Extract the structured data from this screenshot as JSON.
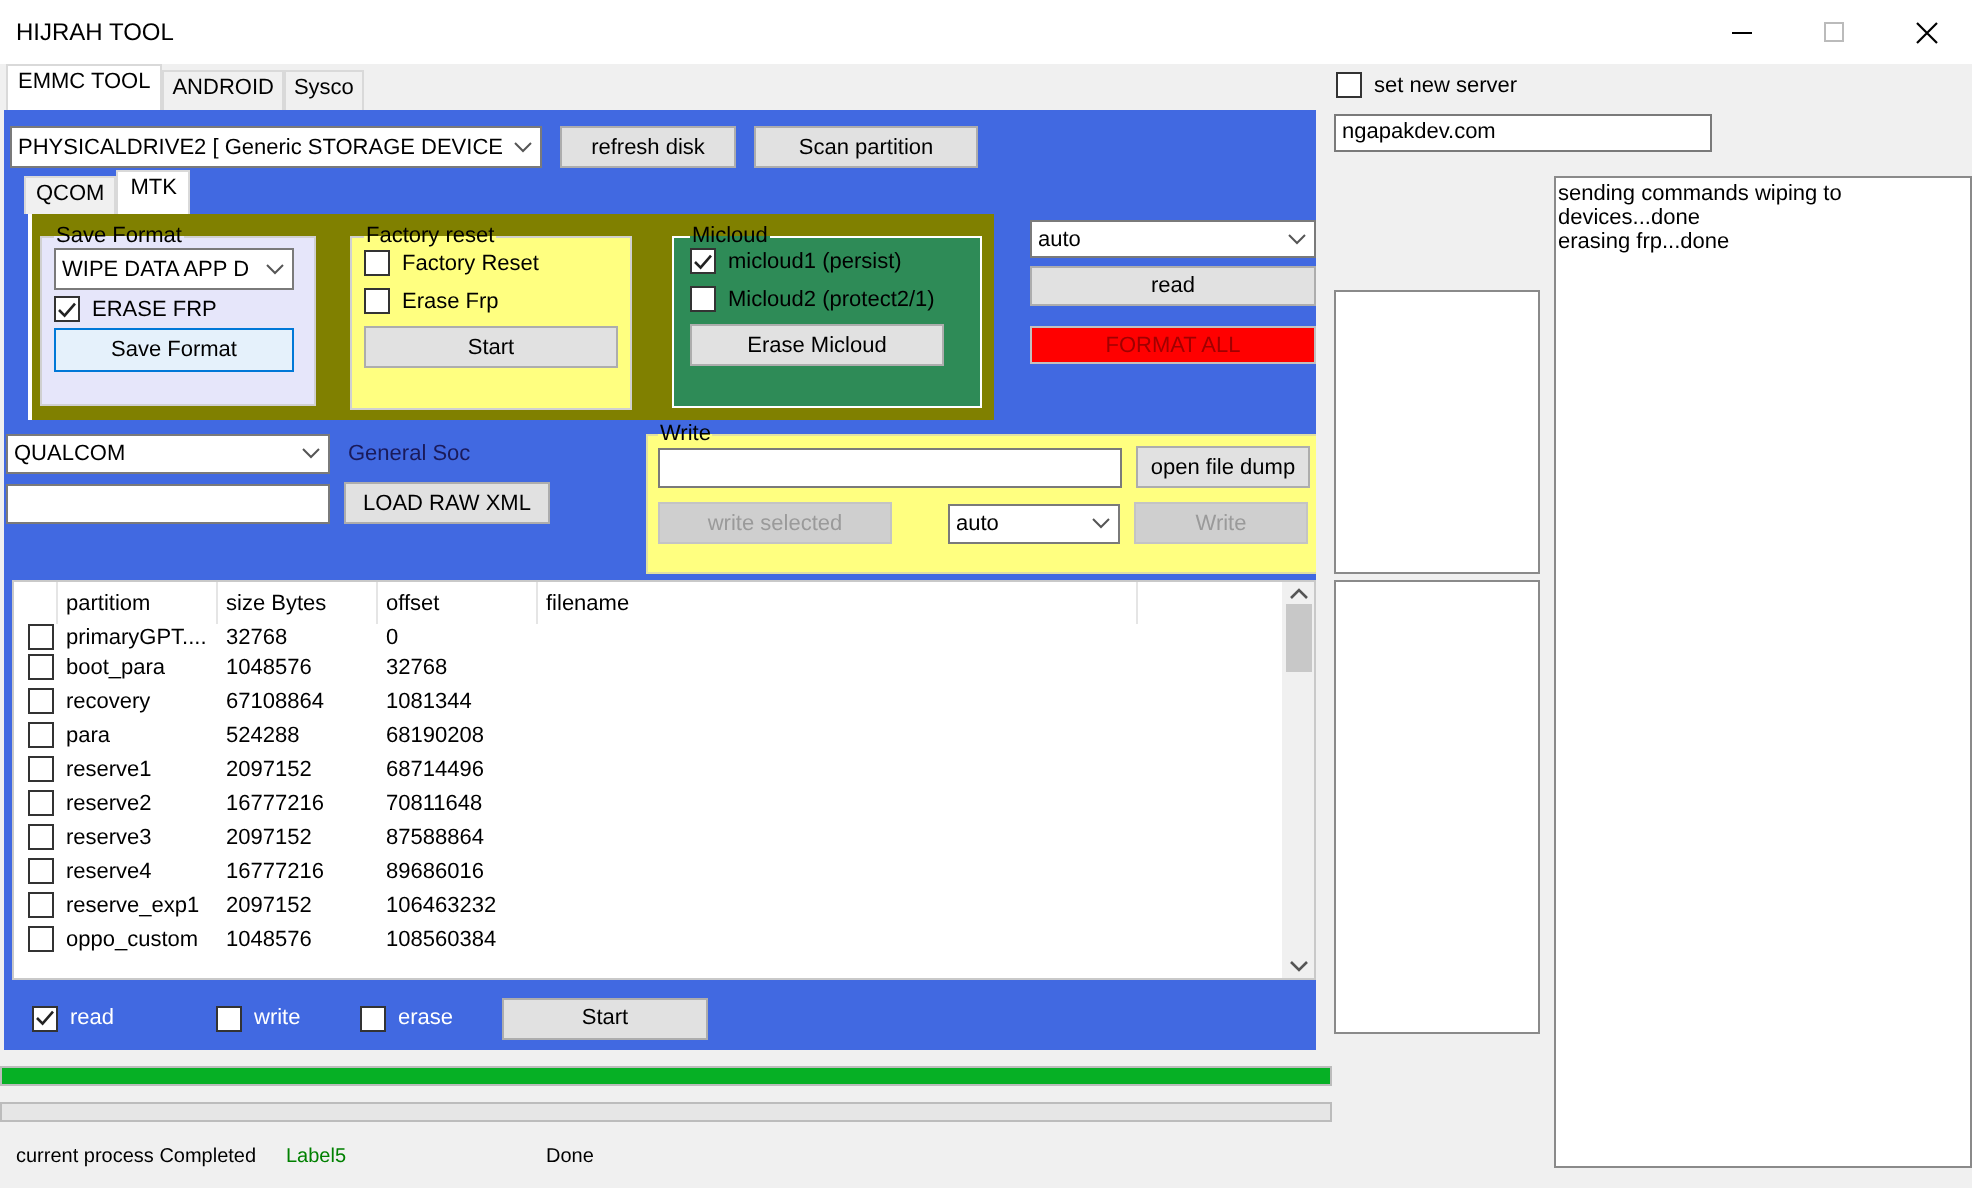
{
  "window": {
    "title": "HIJRAH TOOL"
  },
  "tabs": [
    {
      "label": "EMMC TOOL",
      "selected": true
    },
    {
      "label": "ANDROID",
      "selected": false
    },
    {
      "label": "Sysco",
      "selected": false
    }
  ],
  "disk": {
    "combo": "PHYSICALDRIVE2 [ Generic STORAGE DEVICE",
    "buttons": [
      "refresh disk",
      "Scan partition"
    ]
  },
  "chip_tabs": [
    {
      "label": "QCOM",
      "selected": false
    },
    {
      "label": "MTK",
      "selected": true
    }
  ],
  "save_format": {
    "title": "Save Format",
    "combo": "WIPE DATA APP D",
    "checkbox": {
      "label": "ERASE FRP",
      "checked": true
    },
    "button": "Save Format"
  },
  "factory_reset": {
    "title": "Factory reset",
    "checkboxes": [
      {
        "label": "Factory Reset",
        "checked": false
      },
      {
        "label": "Erase Frp",
        "checked": false
      }
    ],
    "button": "Start"
  },
  "micloud": {
    "title": "Micloud",
    "checkboxes": [
      {
        "label": "micloud1 (persist)",
        "checked": true
      },
      {
        "label": "Micloud2 (protect2/1)",
        "checked": false
      }
    ],
    "button": "Erase Micloud"
  },
  "read_panel": {
    "combo": "auto",
    "read_button": "read",
    "format_button": "FORMAT ALL"
  },
  "soc": {
    "combo": "QUALCOM",
    "label": "General Soc",
    "button": "LOAD RAW XML"
  },
  "write": {
    "title": "Write",
    "open_button": {
      "label": "open file dump",
      "disabled": false
    },
    "select_button": {
      "label": "write selected",
      "disabled": true
    },
    "combo": "auto",
    "write_button": {
      "label": "Write",
      "disabled": true
    }
  },
  "table": {
    "columns": [
      "partitiom",
      "size Bytes",
      "offset",
      "filename"
    ],
    "rows": [
      {
        "checked": false,
        "cells": [
          "primaryGPT....",
          "32768",
          "0"
        ]
      },
      {
        "checked": false,
        "cells": [
          "boot_para",
          "1048576",
          "32768"
        ]
      },
      {
        "checked": false,
        "cells": [
          "recovery",
          "67108864",
          "1081344"
        ]
      },
      {
        "checked": false,
        "cells": [
          "para",
          "524288",
          "68190208"
        ]
      },
      {
        "checked": false,
        "cells": [
          "reserve1",
          "2097152",
          "68714496"
        ]
      },
      {
        "checked": false,
        "cells": [
          "reserve2",
          "16777216",
          "70811648"
        ]
      },
      {
        "checked": false,
        "cells": [
          "reserve3",
          "2097152",
          "87588864"
        ]
      },
      {
        "checked": false,
        "cells": [
          "reserve4",
          "16777216",
          "89686016"
        ]
      },
      {
        "checked": false,
        "cells": [
          "reserve_exp1",
          "2097152",
          "106463232"
        ]
      },
      {
        "checked": false,
        "cells": [
          "oppo_custom",
          "1048576",
          "108560384"
        ]
      }
    ]
  },
  "modes": [
    {
      "label": "read",
      "checked": true
    },
    {
      "label": "write",
      "checked": false
    },
    {
      "label": "erase",
      "checked": false
    }
  ],
  "start_button": "Start",
  "progress": {
    "level": 1
  },
  "status": [
    {
      "text": "current process Completed",
      "color": "#000000"
    },
    {
      "text": "Label5",
      "color": "#008000"
    },
    {
      "text": "Done",
      "color": "#000000"
    }
  ],
  "server": {
    "checkbox": {
      "label": "set new server",
      "checked": false
    },
    "value": "ngapakdev.com"
  },
  "log": [
    "sending commands wiping to devices...done",
    "erasing frp...done"
  ]
}
